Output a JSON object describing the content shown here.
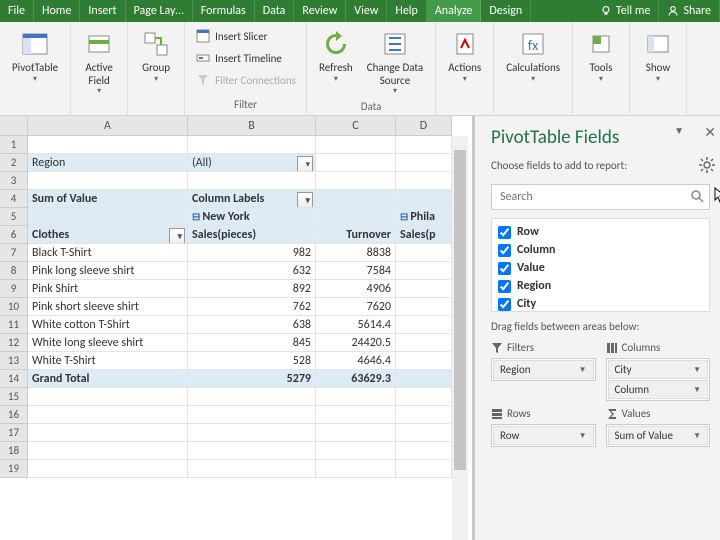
{
  "menu": {
    "tabs": [
      "File",
      "Home",
      "Insert",
      "Page Lay…",
      "Formulas",
      "Data",
      "Review",
      "View",
      "Help",
      "Analyze",
      "Design"
    ],
    "active": 9,
    "tellme": "Tell me",
    "share": "Share"
  },
  "ribbon": {
    "pivottable": "PivotTable",
    "activefield": "Active Field",
    "group": "Group",
    "slicer": "Insert Slicer",
    "timeline": "Insert Timeline",
    "filtconn": "Filter Connections",
    "filter_lbl": "Filter",
    "refresh": "Refresh",
    "chgsrc": "Change Data Source",
    "data_lbl": "Data",
    "actions": "Actions",
    "calc": "Calculations",
    "tools": "Tools",
    "show": "Show"
  },
  "cols": [
    "A",
    "B",
    "C",
    "D"
  ],
  "pt": {
    "filter_field": "Region",
    "filter_val": "(All)",
    "measure": "Sum of Value",
    "collbl": "Column Labels",
    "city1": "New York",
    "city2": "Phila",
    "rowhdr": "Clothes",
    "c1": "Sales(pieces)",
    "c2": "Turnover",
    "c3": "Sales(p",
    "rows": [
      {
        "n": "Black T-Shirt",
        "s": "982",
        "t": "8838"
      },
      {
        "n": "Pink long sleeve shirt",
        "s": "632",
        "t": "7584"
      },
      {
        "n": "Pink Shirt",
        "s": "892",
        "t": "4906"
      },
      {
        "n": "Pink short sleeve shirt",
        "s": "762",
        "t": "7620"
      },
      {
        "n": "White cotton T-Shirt",
        "s": "638",
        "t": "5614.4"
      },
      {
        "n": "White long sleeve shirt",
        "s": "845",
        "t": "24420.5"
      },
      {
        "n": "White T-Shirt",
        "s": "528",
        "t": "4646.4"
      }
    ],
    "gt": "Grand Total",
    "gts": "5279",
    "gtt": "63629.3"
  },
  "pane": {
    "title": "PivotTable Fields",
    "sub": "Choose fields to add to report:",
    "search": "Search",
    "fields": [
      "Row",
      "Column",
      "Value",
      "Region",
      "City"
    ],
    "drag": "Drag fields between areas below:",
    "a_filters": "Filters",
    "a_cols": "Columns",
    "a_rows": "Rows",
    "a_vals": "Values",
    "filters": [
      "Region"
    ],
    "cols": [
      "City",
      "Column"
    ],
    "rows": [
      "Row"
    ],
    "vals": [
      "Sum of Value"
    ]
  }
}
